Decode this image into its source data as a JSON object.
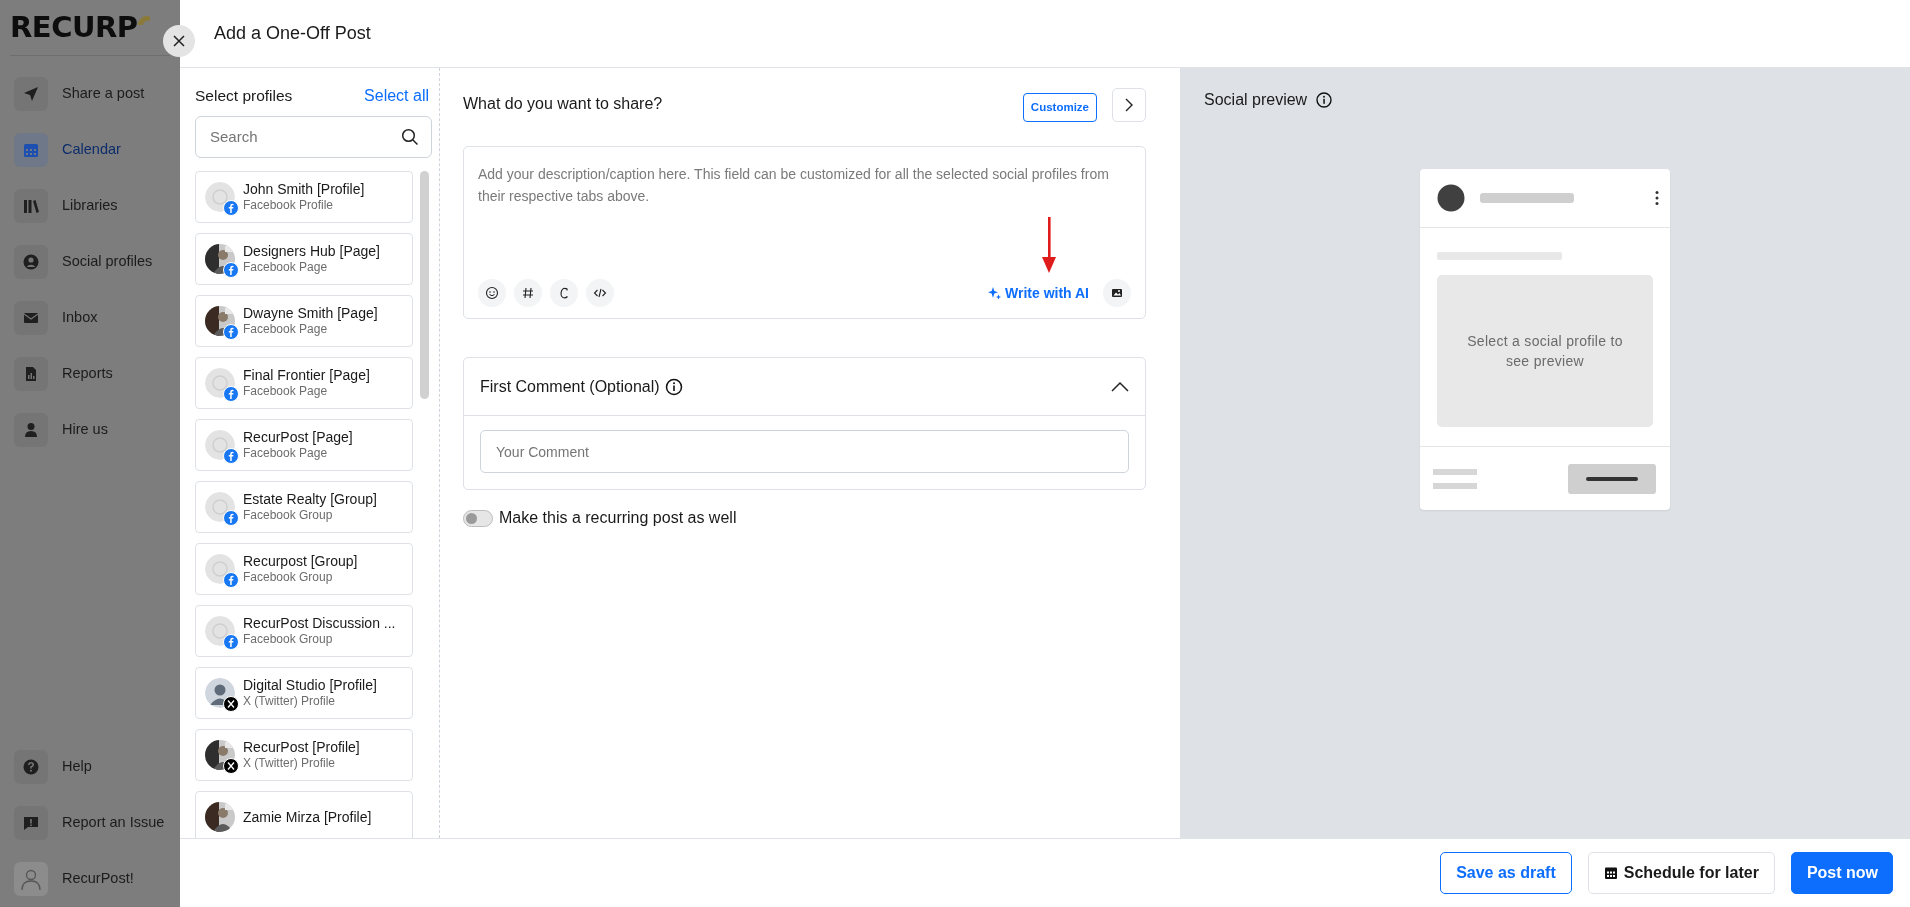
{
  "sidebar": {
    "logo": "RECURP",
    "items": [
      {
        "label": "Share a post",
        "selected": false
      },
      {
        "label": "Calendar",
        "selected": true
      },
      {
        "label": "Libraries",
        "selected": false
      },
      {
        "label": "Social profiles",
        "selected": false
      },
      {
        "label": "Inbox",
        "selected": false
      },
      {
        "label": "Reports",
        "selected": false
      },
      {
        "label": "Hire us",
        "selected": false
      }
    ],
    "bottom_items": [
      {
        "label": "Help",
        "selected": false
      },
      {
        "label": "Report an Issue",
        "selected": false
      }
    ],
    "user": {
      "name": "RecurPost!"
    }
  },
  "modal": {
    "title": "Add a One-Off Post"
  },
  "profiles": {
    "title": "Select profiles",
    "select_all": "Select all",
    "search": {
      "placeholder": "Search"
    },
    "items": [
      {
        "name": "John Smith [Profile]",
        "type": "Facebook Profile",
        "kind": "facebook"
      },
      {
        "name": "Designers Hub [Page]",
        "type": "Facebook Page",
        "kind": "facebook"
      },
      {
        "name": "Dwayne Smith [Page]",
        "type": "Facebook Page",
        "kind": "facebook"
      },
      {
        "name": "Final Frontier [Page]",
        "type": "Facebook Page",
        "kind": "facebook"
      },
      {
        "name": "RecurPost [Page]",
        "type": "Facebook Page",
        "kind": "facebook"
      },
      {
        "name": "Estate Realty [Group]",
        "type": "Facebook Group",
        "kind": "facebook"
      },
      {
        "name": "Recurpost [Group]",
        "type": "Facebook Group",
        "kind": "facebook"
      },
      {
        "name": "RecurPost Discussion ...",
        "type": "Facebook Group",
        "kind": "facebook"
      },
      {
        "name": "Digital Studio [Profile]",
        "type": "X (Twitter) Profile",
        "kind": "x"
      },
      {
        "name": "RecurPost [Profile]",
        "type": "X (Twitter) Profile",
        "kind": "x"
      },
      {
        "name": "Zamie Mirza [Profile]"
      }
    ]
  },
  "composer": {
    "title": "What do you want to share?",
    "customize": "Customize",
    "caption": {
      "placeholder": "Add your description/caption here. This field can be customized for all the selected social profiles from their respective tabs above."
    },
    "write_with_ai": "Write with AI"
  },
  "first_comment": {
    "title": "First Comment (Optional)",
    "expanded": true,
    "placeholder": "Your Comment"
  },
  "recurring": {
    "label": "Make this a recurring post as well",
    "on": false
  },
  "preview": {
    "title": "Social preview",
    "message": "Select a social profile to see preview"
  },
  "footer": {
    "buttons": [
      {
        "label": "Save as draft",
        "kind": "outline"
      },
      {
        "label": "Schedule for later",
        "kind": "schedule"
      },
      {
        "label": "Post now",
        "kind": "primary"
      }
    ]
  }
}
